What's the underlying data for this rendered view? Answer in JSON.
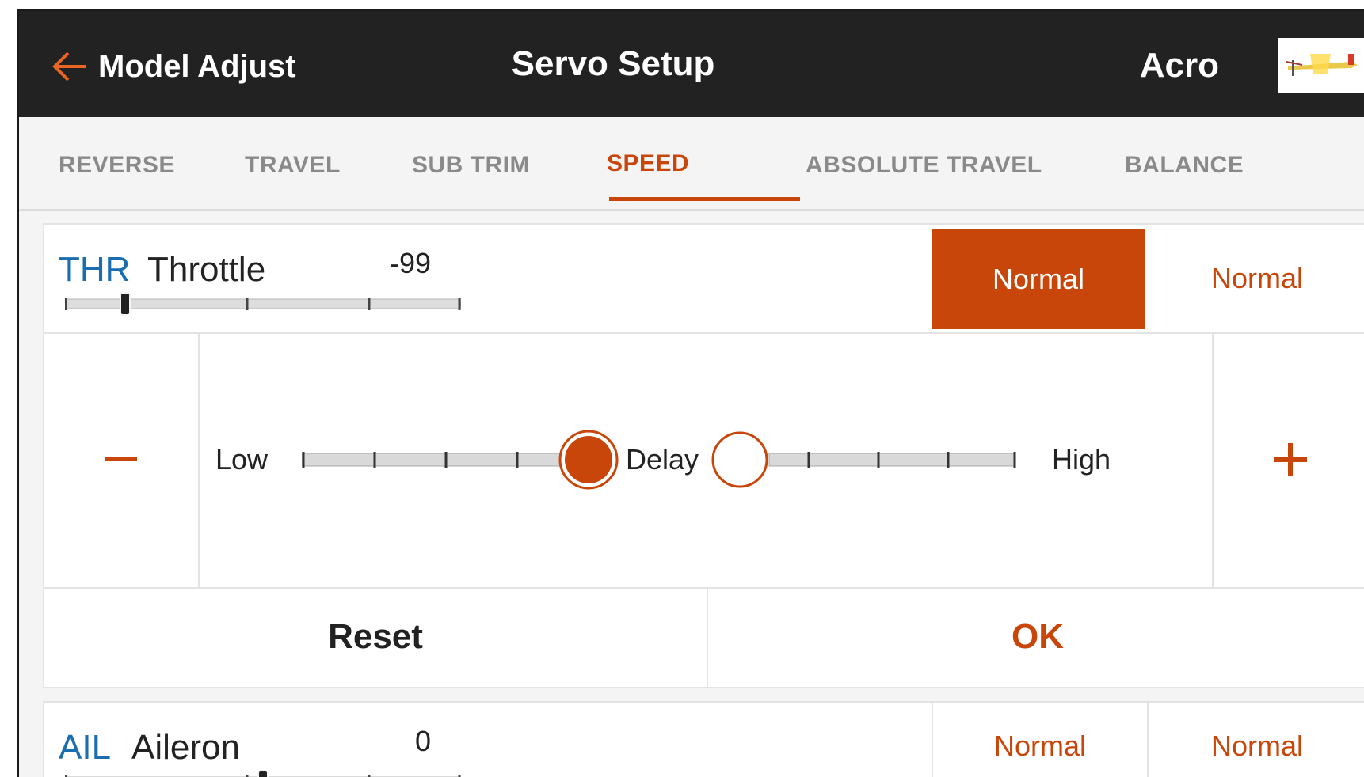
{
  "header": {
    "back_label": "Model Adjust",
    "title": "Servo Setup",
    "model_name": "Acro"
  },
  "tabs": [
    {
      "label": "REVERSE"
    },
    {
      "label": "TRAVEL"
    },
    {
      "label": "SUB TRIM"
    },
    {
      "label": "SPEED",
      "active": true
    },
    {
      "label": "ABSOLUTE TRAVEL"
    },
    {
      "label": "BALANCE"
    }
  ],
  "channels": [
    {
      "abbr": "THR",
      "name": "Throttle",
      "value": "-99",
      "position": -99,
      "speed_up": "Normal",
      "speed_down": "Normal",
      "expanded": true,
      "speed_editor": {
        "low_label": "Low",
        "center_label": "Delay",
        "high_label": "High",
        "reset_label": "Reset",
        "ok_label": "OK"
      }
    },
    {
      "abbr": "AIL",
      "name": "Aileron",
      "value": "0",
      "position": 0,
      "speed_up": "Normal",
      "speed_down": "Normal"
    }
  ],
  "colors": {
    "accent": "#c9460a",
    "header_bg": "#222222",
    "channel_abbr": "#1a6eb0"
  },
  "icons": {
    "back": "arrow-left-icon",
    "decrease": "minus-icon",
    "increase": "plus-icon",
    "model": "airplane-thumbnail"
  }
}
